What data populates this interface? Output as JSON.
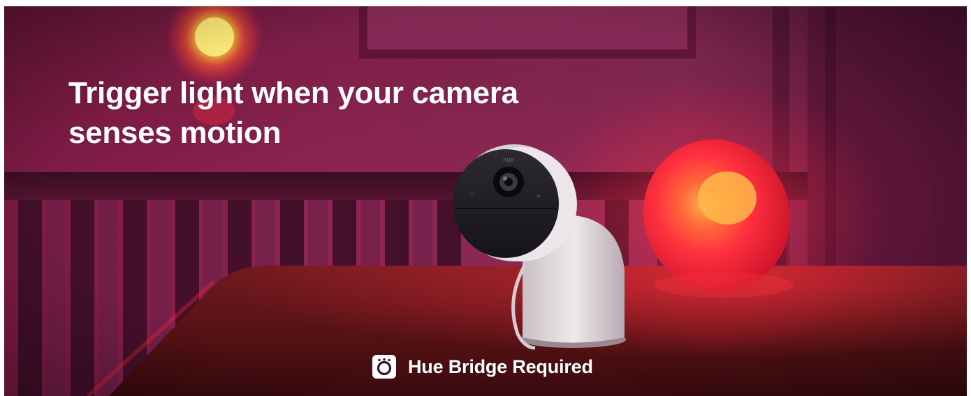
{
  "hero": {
    "headline_line1": "Trigger light when your camera",
    "headline_line2": "senses motion",
    "badge": {
      "icon": "hue-bridge-icon",
      "label": "Hue Bridge Required"
    }
  },
  "colors": {
    "wall": "#8a1e4e",
    "table": "#5a1414",
    "lamp_glow": "#ff2d3c",
    "lamp_core": "#ffb347",
    "camera_body": "#e8e2e6",
    "camera_face": "#1f1d22",
    "text": "#ffffff"
  }
}
